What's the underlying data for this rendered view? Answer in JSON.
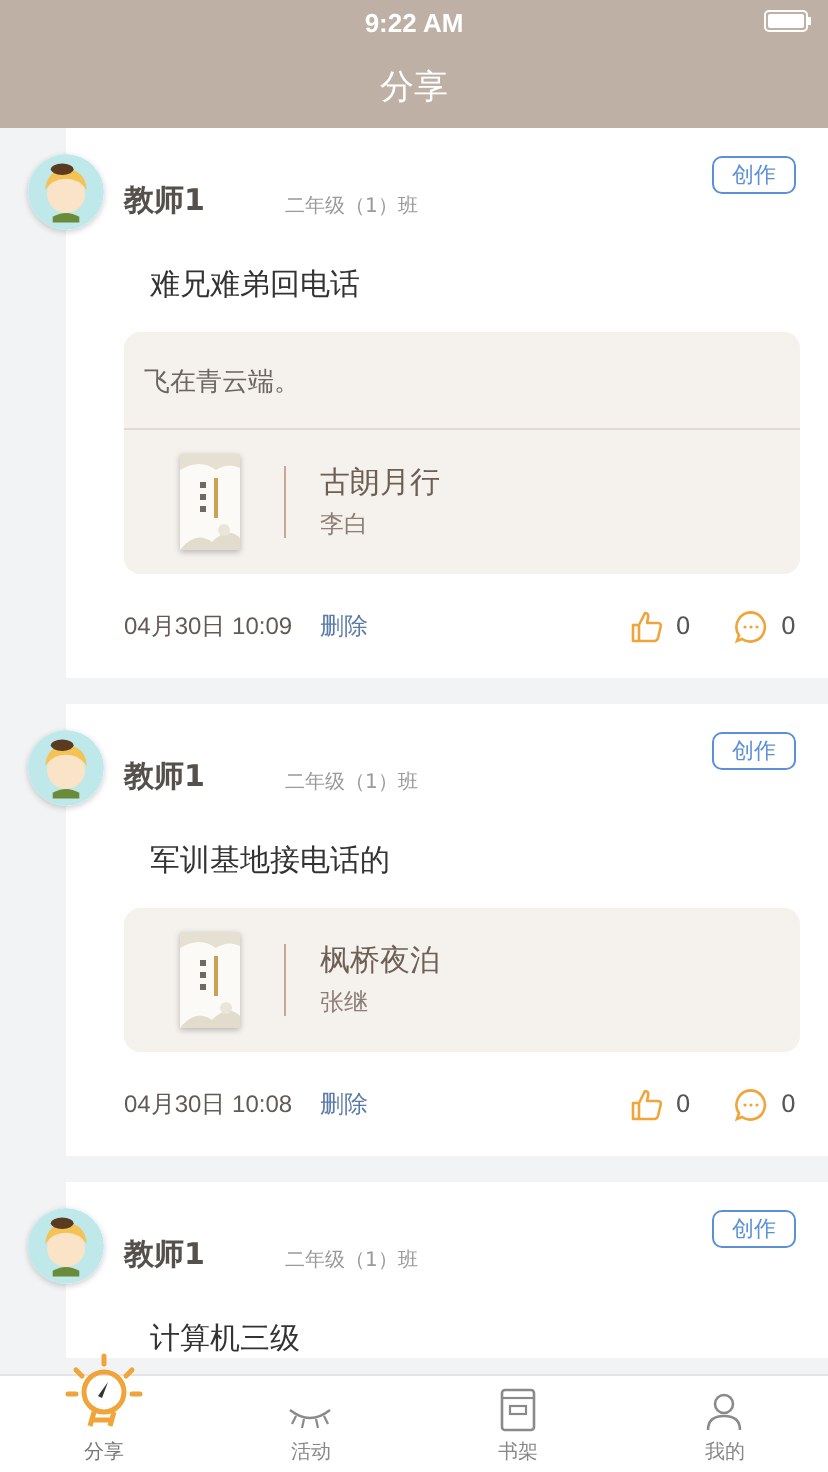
{
  "status_bar": {
    "time": "9:22 AM"
  },
  "header": {
    "title": "分享"
  },
  "posts": [
    {
      "author": "教师1",
      "class_name": "二年级（1）班",
      "action": "创作",
      "title": "难兄难弟回电话",
      "quote": "飞在青云端。",
      "book": {
        "title": "古朗月行",
        "author": "李白"
      },
      "time": "04月30日 10:09",
      "delete": "删除",
      "likes": "0",
      "comments": "0"
    },
    {
      "author": "教师1",
      "class_name": "二年级（1）班",
      "action": "创作",
      "title": "军训基地接电话的",
      "book": {
        "title": "枫桥夜泊",
        "author": "张继"
      },
      "time": "04月30日 10:08",
      "delete": "删除",
      "likes": "0",
      "comments": "0"
    },
    {
      "author": "教师1",
      "class_name": "二年级（1）班",
      "action": "创作",
      "title": "计算机三级"
    }
  ],
  "tabs": [
    {
      "label": "分享",
      "kind": "bulb",
      "selected": true
    },
    {
      "label": "活动",
      "kind": "eye",
      "selected": false
    },
    {
      "label": "书架",
      "kind": "book",
      "selected": false
    },
    {
      "label": "我的",
      "kind": "person",
      "selected": false
    }
  ]
}
